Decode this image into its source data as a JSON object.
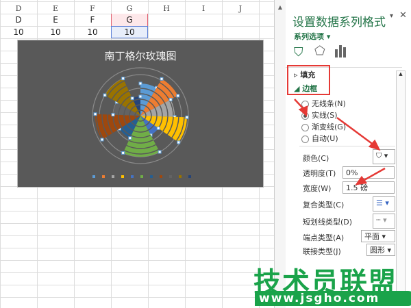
{
  "sheet": {
    "columns": [
      "D",
      "E",
      "F",
      "G",
      "H",
      "I",
      "J"
    ],
    "row1": [
      "D",
      "E",
      "F",
      "G"
    ],
    "row2": [
      "10",
      "10",
      "10",
      "10"
    ],
    "selected_column": "G"
  },
  "chart": {
    "title": "南丁格尔玫瑰图"
  },
  "chart_data": {
    "type": "rose",
    "title": "南丁格尔玫瑰图",
    "series": [
      {
        "color": "#5b9bd5",
        "start": 0,
        "end": 30,
        "value": 47
      },
      {
        "color": "#ed7d31",
        "start": 30,
        "end": 62,
        "value": 62
      },
      {
        "color": "#a5a5a5",
        "start": 62,
        "end": 92,
        "value": 50
      },
      {
        "color": "#ffc000",
        "start": 92,
        "end": 125,
        "value": 68
      },
      {
        "color": "#4472c4",
        "start": 125,
        "end": 152,
        "value": 32
      },
      {
        "color": "#70ad47",
        "start": 152,
        "end": 205,
        "value": 60
      },
      {
        "color": "#255e91",
        "start": 205,
        "end": 238,
        "value": 36
      },
      {
        "color": "#9e480e",
        "start": 238,
        "end": 272,
        "value": 66
      },
      {
        "color": "#636363",
        "start": 272,
        "end": 300,
        "value": 40
      },
      {
        "color": "#997300",
        "start": 300,
        "end": 335,
        "value": 60
      },
      {
        "color": "#264478",
        "start": 335,
        "end": 360,
        "value": 28
      }
    ]
  },
  "panel": {
    "title": "设置数据系列格式",
    "series_options": "系列选项",
    "sections": {
      "fill": "填充",
      "border": "边框"
    },
    "radios": [
      {
        "label": "无线条(N)",
        "on": false
      },
      {
        "label": "实线(S)",
        "on": true
      },
      {
        "label": "渐变线(G)",
        "on": false
      },
      {
        "label": "自动(U)",
        "on": false
      }
    ],
    "color_label": "颜色(C)",
    "transparency_label": "透明度(T)",
    "transparency_value": "0%",
    "width_label": "宽度(W)",
    "width_value": "1.5 磅",
    "compound_label": "复合类型(C)",
    "dash_label": "短划线类型(D)",
    "cap_label": "端点类型(A)",
    "cap_value": "平面",
    "join_label": "联接类型(J)",
    "join_value": "圆形"
  },
  "watermark": {
    "text": "技术员联盟",
    "url": "www.jsgho.com"
  }
}
